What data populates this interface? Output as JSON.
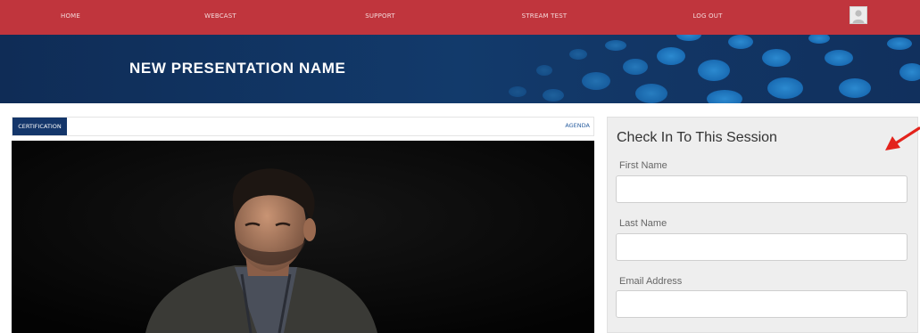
{
  "nav": {
    "items": [
      {
        "label": "HOME"
      },
      {
        "label": "WEBCAST"
      },
      {
        "label": "SUPPORT"
      },
      {
        "label": "STREAM TEST"
      },
      {
        "label": "LOG OUT"
      }
    ],
    "avatar_icon": "user-avatar-icon"
  },
  "banner": {
    "title": "NEW PRESENTATION NAME"
  },
  "tabs": {
    "certification": "CERTIFICATION",
    "agenda": "AGENDA"
  },
  "checkin": {
    "title": "Check In To This Session",
    "fields": [
      {
        "label": "First Name",
        "value": ""
      },
      {
        "label": "Last Name",
        "value": ""
      },
      {
        "label": "Email Address",
        "value": ""
      }
    ]
  },
  "colors": {
    "nav_bg": "#c0353d",
    "banner_bg": "#123a6b",
    "tab_active_bg": "#14366a",
    "annotation_arrow": "#e3231c"
  }
}
